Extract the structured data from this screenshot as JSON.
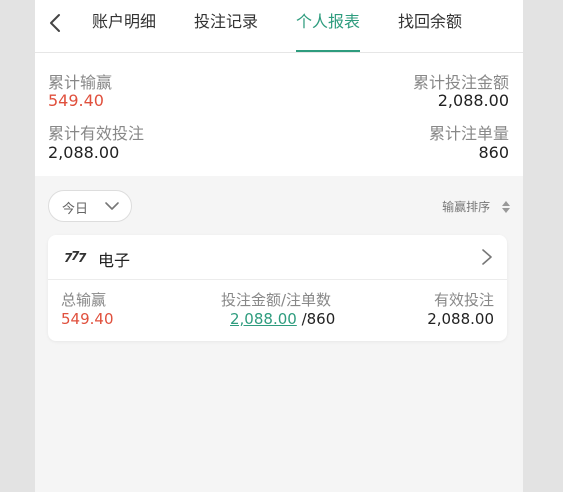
{
  "tabs": [
    {
      "label": "账户明细"
    },
    {
      "label": "投注记录"
    },
    {
      "label": "个人报表",
      "active": true
    },
    {
      "label": "找回余额"
    }
  ],
  "summary": {
    "win_loss_label": "累计输赢",
    "win_loss_value": "549.40",
    "bet_amount_label": "累计投注金额",
    "bet_amount_value": "2,088.00",
    "valid_bet_label": "累计有效投注",
    "valid_bet_value": "2,088.00",
    "bet_count_label": "累计注单量",
    "bet_count_value": "860"
  },
  "filter": {
    "date_label": "今日",
    "sort_label": "输赢排序"
  },
  "card": {
    "icon": "slot-777-icon",
    "title": "电子",
    "total_label": "总输赢",
    "total_value": "549.40",
    "amount_count_label": "投注金额/注单数",
    "amount_value": "2,088.00",
    "count_value": "/860",
    "valid_label": "有效投注",
    "valid_value": "2,088.00"
  },
  "colors": {
    "accent": "#2e9c7e",
    "loss_red": "#e0503d"
  }
}
